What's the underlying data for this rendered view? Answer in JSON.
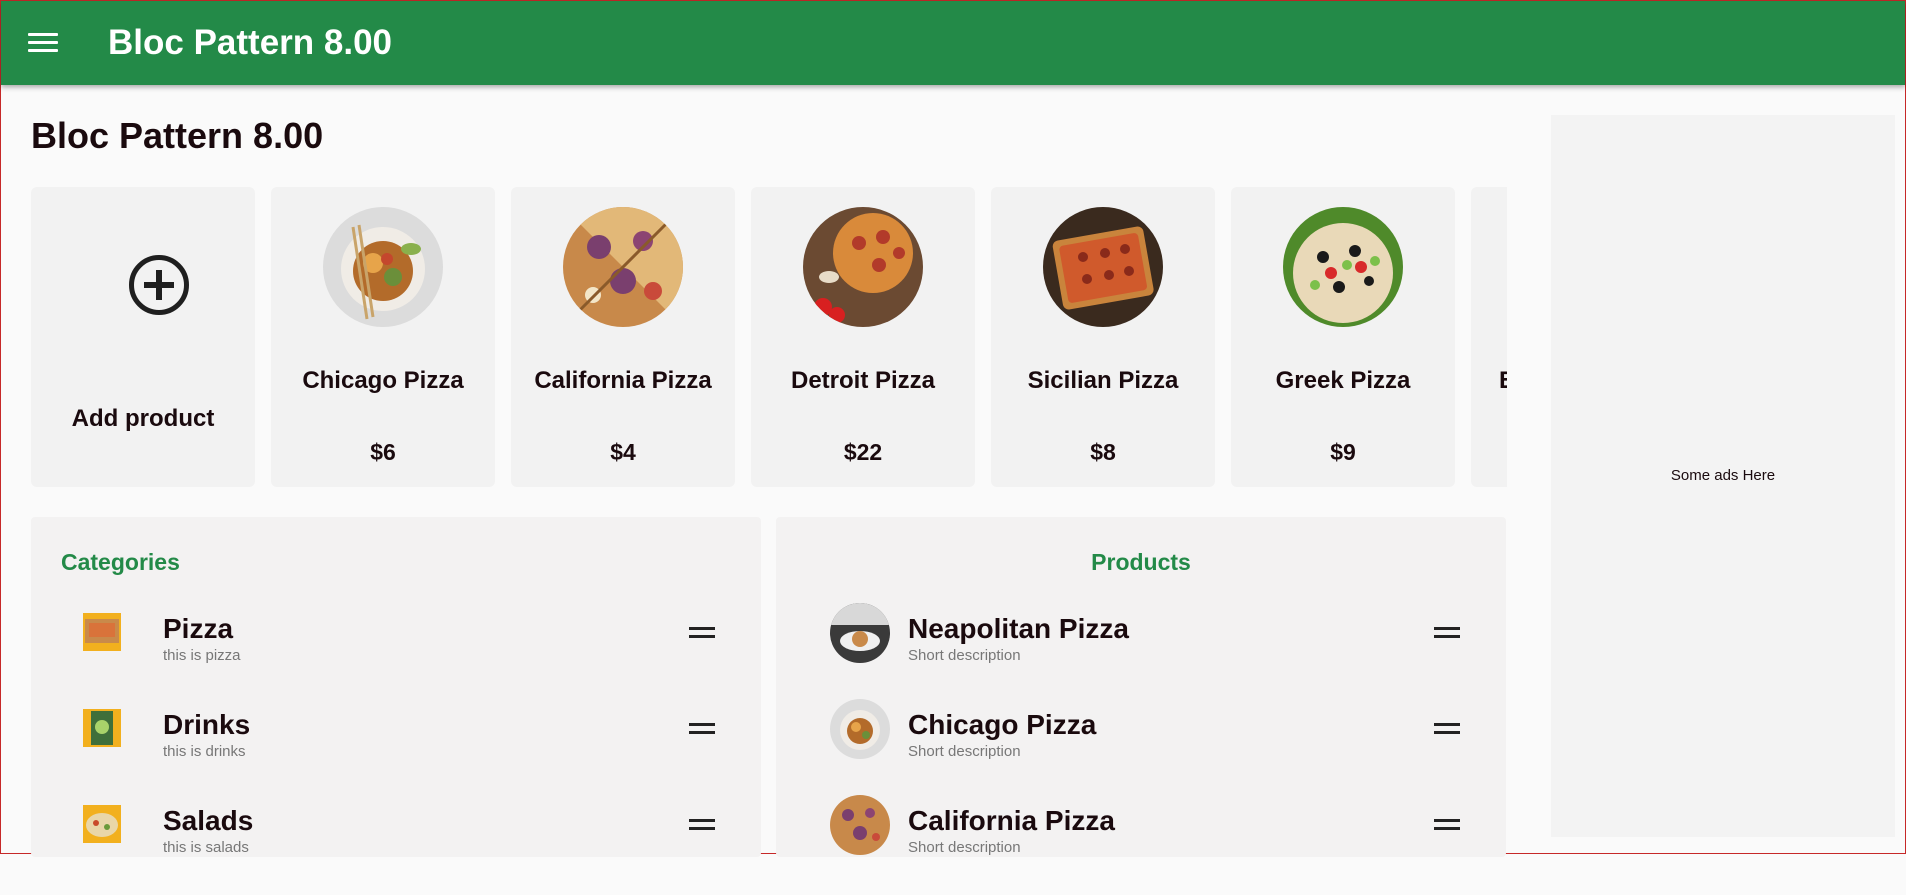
{
  "appbar": {
    "title": "Bloc Pattern 8.00",
    "menu_icon": "menu-icon",
    "bg_color": "#238a48"
  },
  "page": {
    "title": "Bloc Pattern 8.00"
  },
  "carousel": {
    "add_label": "Add product",
    "add_icon": "add-circle-icon",
    "items": [
      {
        "name": "Chicago Pizza",
        "price": "$6"
      },
      {
        "name": "California Pizza",
        "price": "$4"
      },
      {
        "name": "Detroit Pizza",
        "price": "$22"
      },
      {
        "name": "Sicilian Pizza",
        "price": "$8"
      },
      {
        "name": "Greek Pizza",
        "price": "$9"
      },
      {
        "name": "B"
      }
    ]
  },
  "categories": {
    "title": "Categories",
    "items": [
      {
        "title": "Pizza",
        "subtitle": "this is pizza"
      },
      {
        "title": "Drinks",
        "subtitle": "this is drinks"
      },
      {
        "title": "Salads",
        "subtitle": "this is salads"
      }
    ]
  },
  "products": {
    "title": "Products",
    "items": [
      {
        "title": "Neapolitan Pizza",
        "subtitle": "Short description"
      },
      {
        "title": "Chicago Pizza",
        "subtitle": "Short description"
      },
      {
        "title": "California Pizza",
        "subtitle": "Short description"
      }
    ]
  },
  "ads": {
    "text": "Some ads Here"
  },
  "colors": {
    "accent": "#238a48",
    "card_bg": "#f2f2f2"
  }
}
